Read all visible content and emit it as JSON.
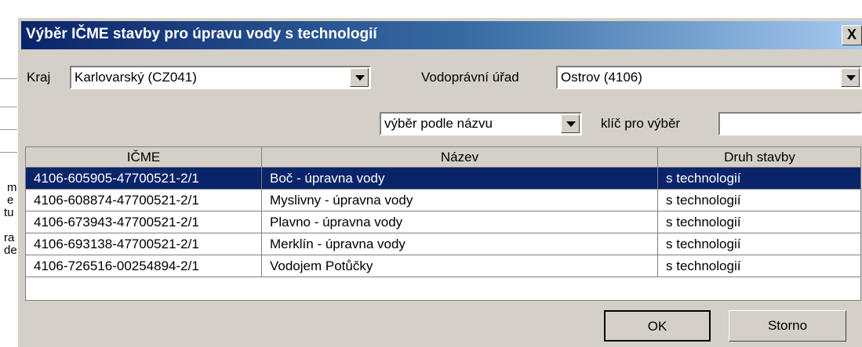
{
  "background_fragments": [
    "m",
    "e",
    "tu",
    "ra",
    "de"
  ],
  "dialog": {
    "title": "Výběr IČME stavby pro úpravu vody s technologií",
    "close_label": "X"
  },
  "filters": {
    "kraj_label": "Kraj",
    "kraj_value": "Karlovarský (CZ041)",
    "urad_label": "Vodoprávní úřad",
    "urad_value": "Ostrov (4106)",
    "mode_value": "výběr podle názvu",
    "key_label": "klíč pro výběr",
    "key_value": ""
  },
  "table": {
    "columns": [
      "IČME",
      "Název",
      "Druh stavby"
    ],
    "selected_row": 0,
    "rows": [
      [
        "4106-605905-47700521-2/1",
        "Boč - úpravna vody",
        "s technologií"
      ],
      [
        "4106-608874-47700521-2/1",
        "Myslivny - úpravna vody",
        "s technologií"
      ],
      [
        "4106-673943-47700521-2/1",
        "Plavno - úpravna vody",
        "s technologií"
      ],
      [
        "4106-693138-47700521-2/1",
        "Merklín - úpravna vody",
        "s technologií"
      ],
      [
        "4106-726516-00254894-2/1",
        "Vodojem Potůčky",
        "s technologií"
      ]
    ]
  },
  "buttons": {
    "ok": "OK",
    "cancel": "Storno"
  }
}
